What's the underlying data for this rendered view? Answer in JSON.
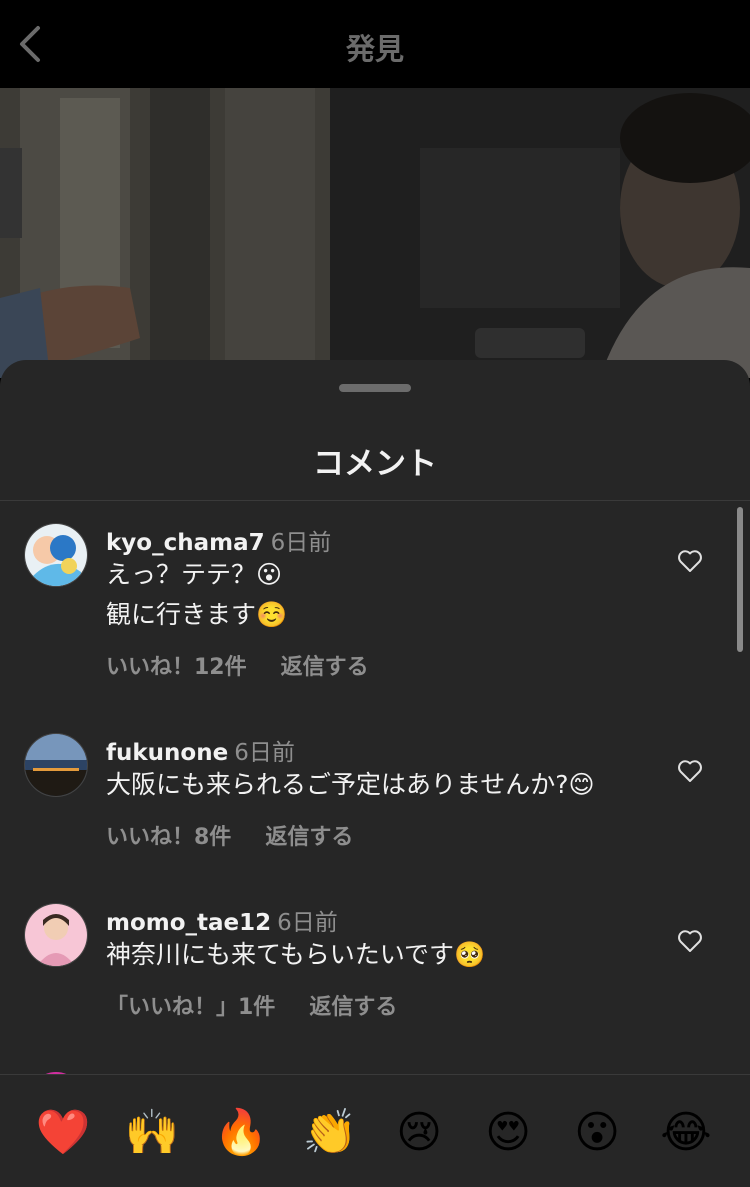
{
  "nav": {
    "title": "発見",
    "back_icon": "chevron-left-icon"
  },
  "sheet": {
    "title": "コメント"
  },
  "comments": [
    {
      "username": "kyo_chama7",
      "time": "6日前",
      "lines": [
        "えっ？テテ？😮",
        "観に行きます☺️"
      ],
      "likes": "いいね！12件",
      "reply": "返信する"
    },
    {
      "username": "fukunone",
      "time": "6日前",
      "lines": [
        "大阪にも来られるご予定はありませんか?😊"
      ],
      "likes": "いいね！8件",
      "reply": "返信する"
    },
    {
      "username": "momo_tae12",
      "time": "6日前",
      "lines": [
        "神奈川にも来てもらいたいです🥺"
      ],
      "likes": "「いいね！」1件",
      "reply": "返信する"
    }
  ],
  "reactions": [
    "❤️",
    "🙌",
    "🔥",
    "👏",
    "😢",
    "😍",
    "😮",
    "😂"
  ],
  "colors": {
    "background": "#000000",
    "sheet": "#262626",
    "text": "#f2f2f2",
    "secondary": "#8e8e8e"
  }
}
